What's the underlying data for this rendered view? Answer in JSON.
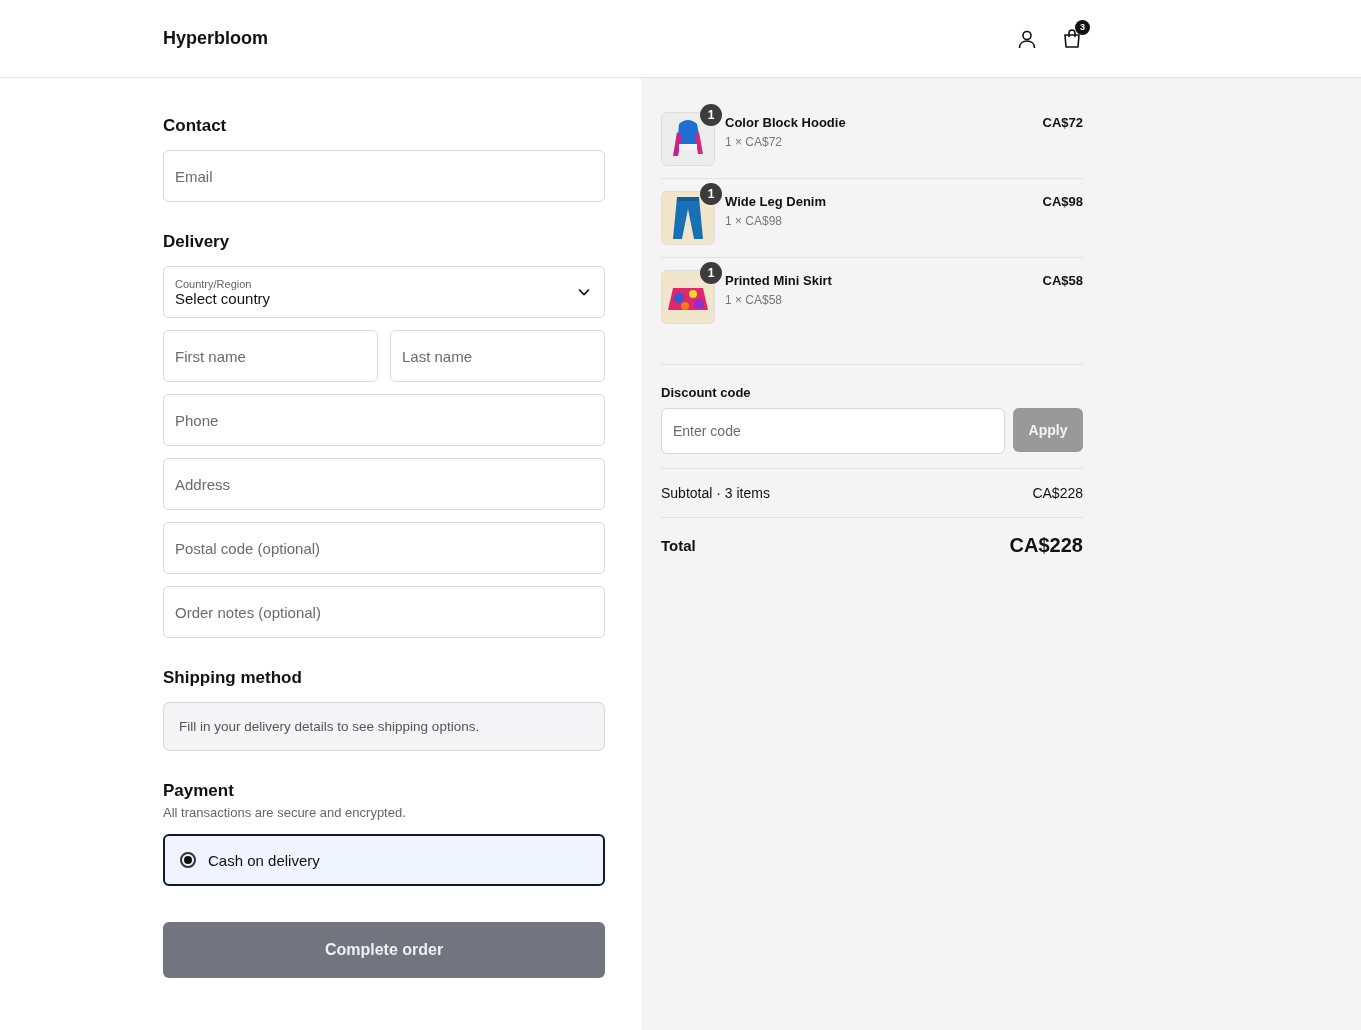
{
  "header": {
    "brand": "Hyperbloom",
    "cart_count": "3"
  },
  "contact": {
    "heading": "Contact",
    "email": {
      "placeholder": "Email"
    }
  },
  "delivery": {
    "heading": "Delivery",
    "country": {
      "label": "Country/Region",
      "value": "Select country"
    },
    "name_fields": [
      {
        "placeholder": "First name"
      },
      {
        "placeholder": "Last name"
      }
    ],
    "fields": [
      {
        "placeholder": "Phone"
      },
      {
        "placeholder": "Address"
      },
      {
        "placeholder": "Postal code (optional)"
      },
      {
        "placeholder": "Order notes (optional)"
      }
    ]
  },
  "shipping": {
    "heading": "Shipping method",
    "notice": "Fill in your delivery details to see shipping options."
  },
  "payment": {
    "heading": "Payment",
    "note": "All transactions are secure and encrypted.",
    "options": [
      {
        "label": "Cash on delivery",
        "selected": true
      }
    ]
  },
  "submit": {
    "label": "Complete order",
    "disabled": true
  },
  "items": [
    {
      "name": "Color Block Hoodie",
      "quantity": "1",
      "unit": "1 × CA$72",
      "price": "CA$72",
      "kind": "hoodie"
    },
    {
      "name": "Wide Leg Denim",
      "quantity": "1",
      "unit": "1 × CA$98",
      "price": "CA$98",
      "kind": "pants"
    },
    {
      "name": "Printed Mini Skirt",
      "quantity": "1",
      "unit": "1 × CA$58",
      "price": "CA$58",
      "kind": "skirt"
    }
  ],
  "discount": {
    "label": "Discount code",
    "placeholder": "Enter code",
    "button": {
      "label": "Apply",
      "disabled": true
    }
  },
  "subtotal": {
    "label": "Subtotal · 3 items",
    "value": "CA$228"
  },
  "total": {
    "label": "Total",
    "value": "CA$228"
  }
}
